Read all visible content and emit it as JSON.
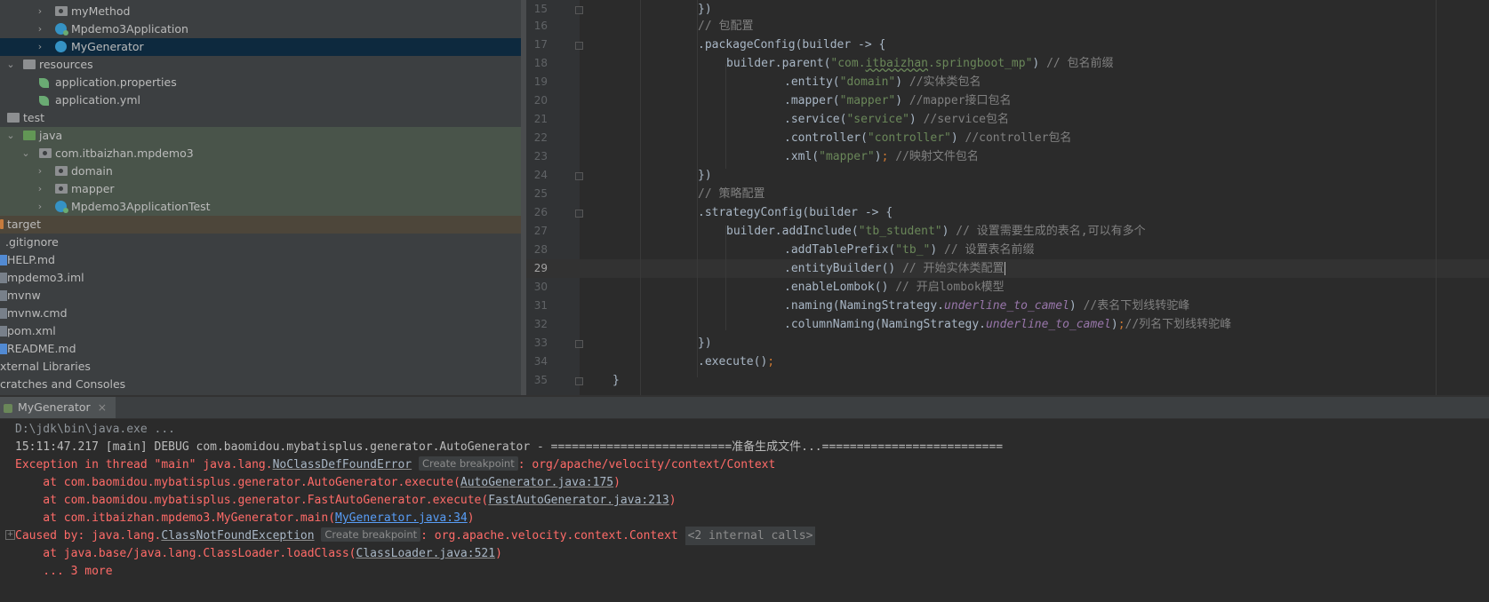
{
  "tree": {
    "items": [
      {
        "label": "myMethod"
      },
      {
        "label": "Mpdemo3Application"
      },
      {
        "label": "MyGenerator"
      },
      {
        "label": "resources"
      },
      {
        "label": "application.properties"
      },
      {
        "label": "application.yml"
      },
      {
        "label": "test"
      },
      {
        "label": "java"
      },
      {
        "label": "com.itbaizhan.mpdemo3"
      },
      {
        "label": "domain"
      },
      {
        "label": "mapper"
      },
      {
        "label": "Mpdemo3ApplicationTest"
      },
      {
        "label": "target"
      },
      {
        "label": ".gitignore"
      },
      {
        "label": "HELP.md"
      },
      {
        "label": "mpdemo3.iml"
      },
      {
        "label": "mvnw"
      },
      {
        "label": "mvnw.cmd"
      },
      {
        "label": "pom.xml"
      },
      {
        "label": "README.md"
      },
      {
        "label": "xternal Libraries"
      },
      {
        "label": "cratches and Consoles"
      }
    ]
  },
  "editor": {
    "line_numbers": [
      "15",
      "16",
      "17",
      "18",
      "19",
      "20",
      "21",
      "22",
      "23",
      "24",
      "25",
      "26",
      "27",
      "28",
      "29",
      "30",
      "31",
      "32",
      "33",
      "34",
      "35"
    ],
    "current_line": "29",
    "code": {
      "l15": {
        "a": "})"
      },
      "l16": {
        "c": "// 包配置"
      },
      "l17": {
        "a": ".packageConfig(builder -> {"
      },
      "l18": {
        "a": "builder.parent(",
        "s1": "\"com.",
        "s2": "itbaizhan",
        "s3": ".springboot_mp\"",
        "b": ") ",
        "c": "// 包名前缀"
      },
      "l19": {
        "a": ".entity(",
        "s": "\"domain\"",
        "b": ") ",
        "c": "//实体类包名"
      },
      "l20": {
        "a": ".mapper(",
        "s": "\"mapper\"",
        "b": ") ",
        "c": "//mapper接口包名"
      },
      "l21": {
        "a": ".service(",
        "s": "\"service\"",
        "b": ") ",
        "c": "//service包名"
      },
      "l22": {
        "a": ".controller(",
        "s": "\"controller\"",
        "b": ") ",
        "c": "//controller包名"
      },
      "l23": {
        "a": ".xml(",
        "s": "\"mapper\"",
        "b": ")",
        "k": ";",
        "c": " //映射文件包名"
      },
      "l24": {
        "a": "})"
      },
      "l25": {
        "c": "// 策略配置"
      },
      "l26": {
        "a": ".strategyConfig(builder -> {"
      },
      "l27": {
        "a": "builder.addInclude(",
        "s": "\"tb_student\"",
        "b": ") ",
        "c": "// 设置需要生成的表名,可以有多个"
      },
      "l28": {
        "a": ".addTablePrefix(",
        "s": "\"tb_\"",
        "b": ") ",
        "c": "// 设置表名前缀"
      },
      "l29": {
        "a": ".entityBuilder() ",
        "c": "// 开始实体类配置"
      },
      "l30": {
        "a": ".enableLombok() ",
        "c": "// 开启lombok模型"
      },
      "l31": {
        "a": ".naming(NamingStrategy.",
        "st": "underline_to_camel",
        "b": ") ",
        "c": "//表名下划线转驼峰"
      },
      "l32": {
        "a": ".columnNaming(NamingStrategy.",
        "st": "underline_to_camel",
        "b": ")",
        "k": ";",
        "c": "//列名下划线转驼峰"
      },
      "l33": {
        "a": "})"
      },
      "l34": {
        "a": ".execute()",
        "k": ";"
      },
      "l35": {
        "a": "}"
      }
    }
  },
  "run": {
    "tab_label": "MyGenerator",
    "tab_close": "×"
  },
  "console": {
    "l1": "D:\\jdk\\bin\\java.exe ...",
    "l2": "15:11:47.217 [main] DEBUG com.baomidou.mybatisplus.generator.AutoGenerator - ==========================准备生成文件...==========================",
    "l3": {
      "a": "Exception in thread \"main\" java.lang.",
      "link": "NoClassDefFoundError",
      "bp": "Create breakpoint",
      "b": ": org/apache/velocity/context/Context"
    },
    "l4": {
      "a": "    at com.baomidou.mybatisplus.generator.AutoGenerator.execute(",
      "link": "AutoGenerator.java:175",
      "b": ")"
    },
    "l5": {
      "a": "    at com.baomidou.mybatisplus.generator.FastAutoGenerator.execute(",
      "link": "FastAutoGenerator.java:213",
      "b": ")"
    },
    "l6": {
      "a": "    at com.itbaizhan.mpdemo3.MyGenerator.main(",
      "link": "MyGenerator.java:34",
      "b": ")"
    },
    "l7": {
      "a": "Caused by: java.lang.",
      "link": "ClassNotFoundException",
      "bp": "Create breakpoint",
      "b": ": org.apache.velocity.context.Context ",
      "internal": "<2 internal calls>"
    },
    "l8": {
      "a": "    at java.base/java.lang.ClassLoader.loadClass(",
      "link": "ClassLoader.java:521",
      "b": ")"
    },
    "l9": "    ... 3 more",
    "expand_glyph": "+"
  },
  "colors": {
    "panel": "#3c3f41",
    "editor_bg": "#2b2b2b",
    "selection": "#0d293e",
    "test_sources": "#49544a",
    "excluded": "#4d463a",
    "string": "#6a8759",
    "comment": "#808080",
    "keyword": "#cc7832",
    "static_field": "#9876aa",
    "error_red": "#ff6b68",
    "link_blue": "#589df6"
  },
  "icons": [
    "chevron-right-icon",
    "chevron-down-icon",
    "folder-icon",
    "spring-class-icon",
    "spring-leaf-icon",
    "file-icon",
    "markdown-icon",
    "run-icon",
    "close-icon",
    "fold-marker-icon",
    "expand-icon"
  ]
}
